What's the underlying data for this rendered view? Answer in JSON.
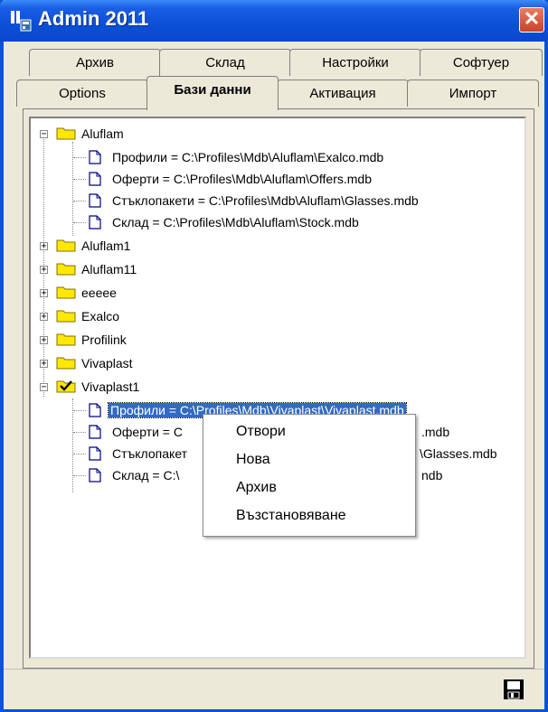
{
  "window": {
    "title": "Admin 2011",
    "close_glyph": "✕"
  },
  "tabs_row1": [
    {
      "label": "Архив"
    },
    {
      "label": "Склад"
    },
    {
      "label": "Настройки"
    },
    {
      "label": "Софтуер"
    }
  ],
  "tabs_row2": [
    {
      "label": "Options"
    },
    {
      "label": "Бази данни",
      "active": true
    },
    {
      "label": "Активация"
    },
    {
      "label": "Импорт"
    }
  ],
  "tree": {
    "groups": [
      {
        "name": "Aluflam",
        "expanded": true,
        "children": [
          "Профили  = C:\\Profiles\\Mdb\\Aluflam\\Exalco.mdb",
          "Оферти  = C:\\Profiles\\Mdb\\Aluflam\\Offers.mdb",
          "Стъклопакети  = C:\\Profiles\\Mdb\\Aluflam\\Glasses.mdb",
          "Склад  = C:\\Profiles\\Mdb\\Aluflam\\Stock.mdb"
        ]
      },
      {
        "name": "Aluflam1"
      },
      {
        "name": "Aluflam11"
      },
      {
        "name": "eeeee"
      },
      {
        "name": "Exalco"
      },
      {
        "name": "Profilink"
      },
      {
        "name": "Vivaplast"
      },
      {
        "name": "Vivaplast1",
        "expanded": true,
        "checked": true,
        "children": [
          "Профили  = C:\\Profiles\\Mdb\\Vivaplast\\Vivaplast.mdb",
          "Оферти  = C",
          "Стъклопакет",
          "Склад  = C:\\"
        ],
        "children_tail": [
          "",
          ".mdb",
          "\\Glasses.mdb",
          "ndb"
        ]
      }
    ]
  },
  "context_menu": {
    "items": [
      "Отвори",
      "Нова",
      "Архив",
      "Възстановяване"
    ]
  },
  "colors": {
    "titlebar": "#0b4fd6",
    "selection": "#316ac5",
    "folder": "#ffe800",
    "face": "#ece9d8"
  },
  "icons": {
    "save": "floppy-disk-icon",
    "close": "close-icon",
    "folder": "folder-icon",
    "document": "document-icon"
  }
}
